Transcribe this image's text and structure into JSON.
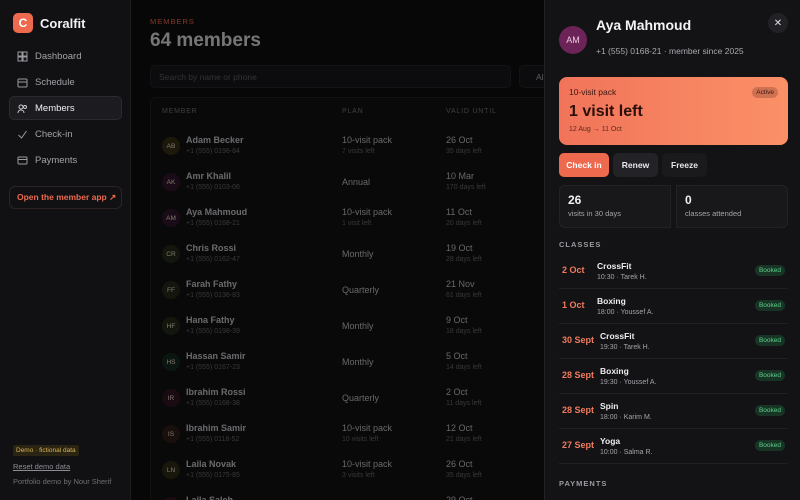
{
  "brand": {
    "logo_letter": "C",
    "name": "Coralfit"
  },
  "nav": [
    {
      "label": "Dashboard",
      "icon": "grid-icon"
    },
    {
      "label": "Schedule",
      "icon": "calendar-icon"
    },
    {
      "label": "Members",
      "icon": "users-icon",
      "active": true
    },
    {
      "label": "Check-in",
      "icon": "check-icon"
    },
    {
      "label": "Payments",
      "icon": "card-icon"
    }
  ],
  "sidebar": {
    "app_link": "Open the member app ↗",
    "demo_badge": "Demo · fictional data",
    "reset_link": "Reset demo data",
    "credit": "Portfolio demo by Nour Sherif"
  },
  "header": {
    "eyebrow": "MEMBERS",
    "title": "64 members"
  },
  "search": {
    "placeholder": "Search by name or phone"
  },
  "filter": {
    "value": "All"
  },
  "table": {
    "columns": [
      "MEMBER",
      "PLAN",
      "VALID UNTIL",
      "S"
    ],
    "rows": [
      {
        "initials": "AB",
        "name": "Adam Becker",
        "phone": "+1 (555) 0196-84",
        "plan": "10-visit pack",
        "plan_sub": "7 visits left",
        "valid": "26 Oct",
        "valid_sub": "35 days left",
        "color": "#7a6a1a"
      },
      {
        "initials": "AK",
        "name": "Amr Khalil",
        "phone": "+1 (555) 0103-06",
        "plan": "Annual",
        "plan_sub": "",
        "valid": "10 Mar",
        "valid_sub": "170 days left",
        "color": "#6b2358"
      },
      {
        "initials": "AM",
        "name": "Aya Mahmoud",
        "phone": "+1 (555) 0168-21",
        "plan": "10-visit pack",
        "plan_sub": "1 visit left",
        "valid": "11 Oct",
        "valid_sub": "20 days left",
        "color": "#6b2358"
      },
      {
        "initials": "CR",
        "name": "Chris Rossi",
        "phone": "+1 (555) 0162-47",
        "plan": "Monthly",
        "plan_sub": "",
        "valid": "19 Oct",
        "valid_sub": "28 days left",
        "color": "#4c5a1d"
      },
      {
        "initials": "FF",
        "name": "Farah Fathy",
        "phone": "+1 (555) 0136-83",
        "plan": "Quarterly",
        "plan_sub": "",
        "valid": "21 Nov",
        "valid_sub": "61 days left",
        "color": "#4c5a1d"
      },
      {
        "initials": "HF",
        "name": "Hana Fathy",
        "phone": "+1 (555) 0198-39",
        "plan": "Monthly",
        "plan_sub": "",
        "valid": "9 Oct",
        "valid_sub": "18 days left",
        "color": "#4c5a1d"
      },
      {
        "initials": "HS",
        "name": "Hassan Samir",
        "phone": "+1 (555) 0167-23",
        "plan": "Monthly",
        "plan_sub": "",
        "valid": "5 Oct",
        "valid_sub": "14 days left",
        "color": "#1f5a36"
      },
      {
        "initials": "IR",
        "name": "Ibrahim Rossi",
        "phone": "+1 (555) 0168-38",
        "plan": "Quarterly",
        "plan_sub": "",
        "valid": "2 Oct",
        "valid_sub": "11 days left",
        "color": "#6b1f3a"
      },
      {
        "initials": "IS",
        "name": "Ibrahim Samir",
        "phone": "+1 (555) 0118-52",
        "plan": "10-visit pack",
        "plan_sub": "10 visits left",
        "valid": "12 Oct",
        "valid_sub": "21 days left",
        "color": "#6b3320"
      },
      {
        "initials": "LN",
        "name": "Laila Novak",
        "phone": "+1 (555) 0175-85",
        "plan": "10-visit pack",
        "plan_sub": "3 visits left",
        "valid": "26 Oct",
        "valid_sub": "35 days left",
        "color": "#6b5a1a"
      },
      {
        "initials": "LS",
        "name": "Laila Saleh",
        "phone": "",
        "plan": "10-visit pack",
        "plan_sub": "",
        "valid": "29 Oct",
        "valid_sub": "",
        "color": "#6b1f3a"
      }
    ]
  },
  "drawer": {
    "initials": "AM",
    "name": "Aya Mahmoud",
    "subtitle": "+1 (555) 0168-21 · member since 2025",
    "close": "✕",
    "pack": {
      "label": "10-visit pack",
      "badge": "Active",
      "big": "1 visit left",
      "range": "12 Aug → 11 Oct"
    },
    "buttons": {
      "checkin": "Check in",
      "renew": "Renew",
      "freeze": "Freeze"
    },
    "stats": [
      {
        "num": "26",
        "label": "visits in 30 days"
      },
      {
        "num": "0",
        "label": "classes attended"
      }
    ],
    "classes_title": "CLASSES",
    "classes": [
      {
        "date": "2 Oct",
        "name": "CrossFit",
        "time": "10:30 · Tarek H.",
        "badge": "Booked"
      },
      {
        "date": "1 Oct",
        "name": "Boxing",
        "time": "18:00 · Youssef A.",
        "badge": "Booked"
      },
      {
        "date": "30 Sept",
        "name": "CrossFit",
        "time": "19:30 · Tarek H.",
        "badge": "Booked"
      },
      {
        "date": "28 Sept",
        "name": "Boxing",
        "time": "19:30 · Youssef A.",
        "badge": "Booked"
      },
      {
        "date": "28 Sept",
        "name": "Spin",
        "time": "18:00 · Karim M.",
        "badge": "Booked"
      },
      {
        "date": "27 Sept",
        "name": "Yoga",
        "time": "10:00 · Salma R.",
        "badge": "Booked"
      }
    ],
    "payments_title": "PAYMENTS"
  },
  "colors": {
    "accent": "#ee6a4f",
    "booked": "#5fcf8c"
  }
}
